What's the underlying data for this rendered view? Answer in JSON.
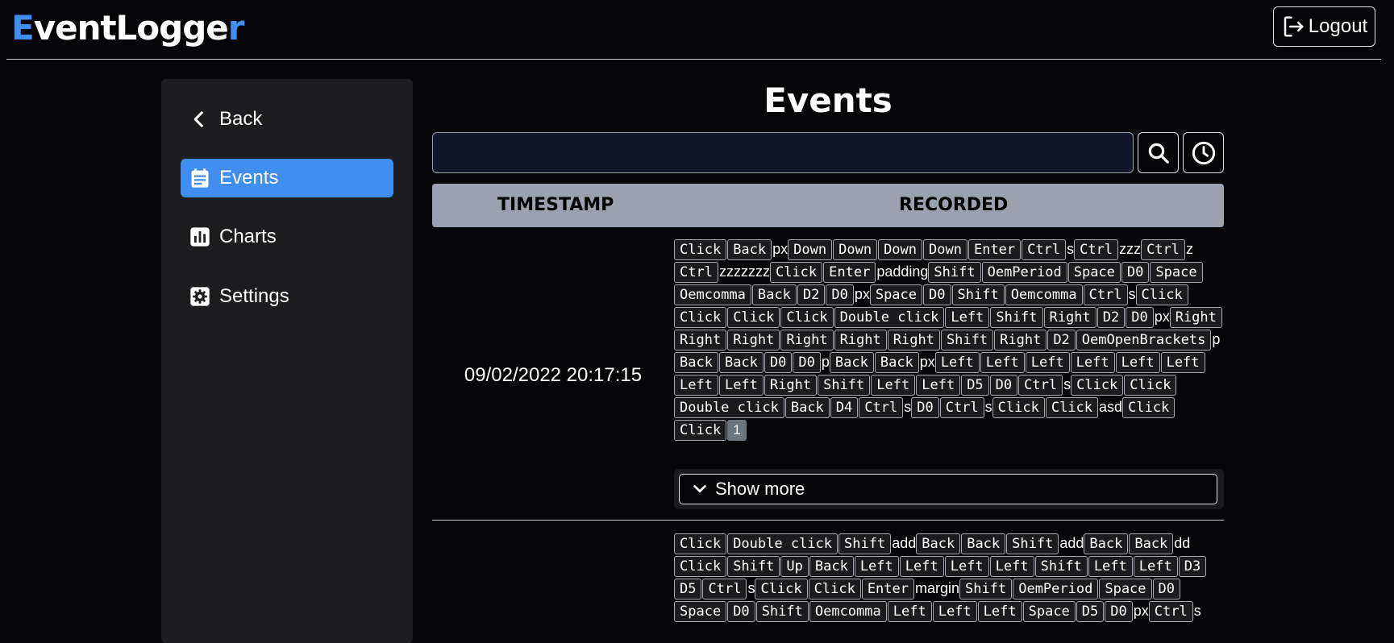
{
  "header": {
    "logo_first": "E",
    "logo_mid": "ventLogge",
    "logo_last": "r",
    "logout_label": "Logout"
  },
  "sidebar": {
    "items": [
      {
        "label": "Back",
        "icon": "chevron-left-icon"
      },
      {
        "label": "Events",
        "icon": "calendar-icon",
        "active": true
      },
      {
        "label": "Charts",
        "icon": "chart-icon"
      },
      {
        "label": "Settings",
        "icon": "gear-icon"
      }
    ]
  },
  "main": {
    "title": "Events",
    "search": {
      "value": "",
      "placeholder": ""
    },
    "table": {
      "headers": [
        "TIMESTAMP",
        "RECORDED"
      ],
      "rows": [
        {
          "timestamp": "09/02/2022 20:17:15",
          "tokens": [
            {
              "k": "Click"
            },
            {
              "k": "Back"
            },
            {
              "t": "px"
            },
            {
              "k": "Down"
            },
            {
              "k": "Down"
            },
            {
              "k": "Down"
            },
            {
              "k": "Down"
            },
            {
              "k": "Enter"
            },
            {
              "k": "Ctrl"
            },
            {
              "t": "s"
            },
            {
              "k": "Ctrl"
            },
            {
              "t": "zzz"
            },
            {
              "k": "Ctrl"
            },
            {
              "t": "z"
            },
            {
              "k": "Ctrl"
            },
            {
              "t": "zzzzzzz"
            },
            {
              "k": "Click"
            },
            {
              "k": "Enter"
            },
            {
              "t": "padding"
            },
            {
              "k": "Shift"
            },
            {
              "k": "OemPeriod"
            },
            {
              "k": "Space"
            },
            {
              "k": "D0"
            },
            {
              "k": "Space"
            },
            {
              "k": "Oemcomma"
            },
            {
              "k": "Back"
            },
            {
              "k": "D2"
            },
            {
              "k": "D0"
            },
            {
              "t": "px"
            },
            {
              "k": "Space"
            },
            {
              "k": "D0"
            },
            {
              "k": "Shift"
            },
            {
              "k": "Oemcomma"
            },
            {
              "k": "Ctrl"
            },
            {
              "t": "s"
            },
            {
              "k": "Click"
            },
            {
              "k": "Click"
            },
            {
              "k": "Click"
            },
            {
              "k": "Click"
            },
            {
              "k": "Double click"
            },
            {
              "k": "Left"
            },
            {
              "k": "Shift"
            },
            {
              "k": "Right"
            },
            {
              "k": "D2"
            },
            {
              "k": "D0"
            },
            {
              "t": "px"
            },
            {
              "k": "Right"
            },
            {
              "k": "Right"
            },
            {
              "k": "Right"
            },
            {
              "k": "Right"
            },
            {
              "k": "Right"
            },
            {
              "k": "Right"
            },
            {
              "k": "Shift"
            },
            {
              "k": "Right"
            },
            {
              "k": "D2"
            },
            {
              "k": "OemOpenBrackets"
            },
            {
              "t": "p"
            },
            {
              "k": "Back"
            },
            {
              "k": "Back"
            },
            {
              "k": "D0"
            },
            {
              "k": "D0"
            },
            {
              "t": "p"
            },
            {
              "k": "Back"
            },
            {
              "k": "Back"
            },
            {
              "t": "px"
            },
            {
              "k": "Left"
            },
            {
              "k": "Left"
            },
            {
              "k": "Left"
            },
            {
              "k": "Left"
            },
            {
              "k": "Left"
            },
            {
              "k": "Left"
            },
            {
              "k": "Left"
            },
            {
              "k": "Left"
            },
            {
              "k": "Right"
            },
            {
              "k": "Shift"
            },
            {
              "k": "Left"
            },
            {
              "k": "Left"
            },
            {
              "k": "D5"
            },
            {
              "k": "D0"
            },
            {
              "k": "Ctrl"
            },
            {
              "t": "s"
            },
            {
              "k": "Click"
            },
            {
              "k": "Click"
            },
            {
              "k": "Double click"
            },
            {
              "k": "Back"
            },
            {
              "k": "D4"
            },
            {
              "k": "Ctrl"
            },
            {
              "t": "s"
            },
            {
              "k": "D0"
            },
            {
              "k": "Ctrl"
            },
            {
              "t": "s"
            },
            {
              "k": "Click"
            },
            {
              "k": "Click"
            },
            {
              "t": "asd"
            },
            {
              "k": "Click"
            },
            {
              "k": "Click"
            },
            {
              "b": "1"
            }
          ],
          "show_more_label": "Show more"
        },
        {
          "timestamp": "",
          "tokens": [
            {
              "k": "Click"
            },
            {
              "k": "Double click"
            },
            {
              "k": "Shift"
            },
            {
              "t": "add"
            },
            {
              "k": "Back"
            },
            {
              "k": "Back"
            },
            {
              "k": "Shift"
            },
            {
              "t": "add"
            },
            {
              "k": "Back"
            },
            {
              "k": "Back"
            },
            {
              "t": "dd"
            },
            {
              "k": "Click"
            },
            {
              "k": "Shift"
            },
            {
              "k": "Up"
            },
            {
              "k": "Back"
            },
            {
              "k": "Left"
            },
            {
              "k": "Left"
            },
            {
              "k": "Left"
            },
            {
              "k": "Left"
            },
            {
              "k": "Shift"
            },
            {
              "k": "Left"
            },
            {
              "k": "Left"
            },
            {
              "k": "D3"
            },
            {
              "k": "D5"
            },
            {
              "k": "Ctrl"
            },
            {
              "t": "s"
            },
            {
              "k": "Click"
            },
            {
              "k": "Click"
            },
            {
              "k": "Enter"
            },
            {
              "t": "margin"
            },
            {
              "k": "Shift"
            },
            {
              "k": "OemPeriod"
            },
            {
              "k": "Space"
            },
            {
              "k": "D0"
            },
            {
              "k": "Space"
            },
            {
              "k": "D0"
            },
            {
              "k": "Shift"
            },
            {
              "k": "Oemcomma"
            },
            {
              "k": "Left"
            },
            {
              "k": "Left"
            },
            {
              "k": "Left"
            },
            {
              "k": "Space"
            },
            {
              "k": "D5"
            },
            {
              "k": "D0"
            },
            {
              "t": "px"
            },
            {
              "k": "Ctrl"
            },
            {
              "t": "s"
            }
          ]
        }
      ]
    }
  },
  "colors": {
    "accent": "#3f8ef0",
    "header_bg": "#9ba1ae",
    "sidebar_bg": "#1d1d1f"
  }
}
